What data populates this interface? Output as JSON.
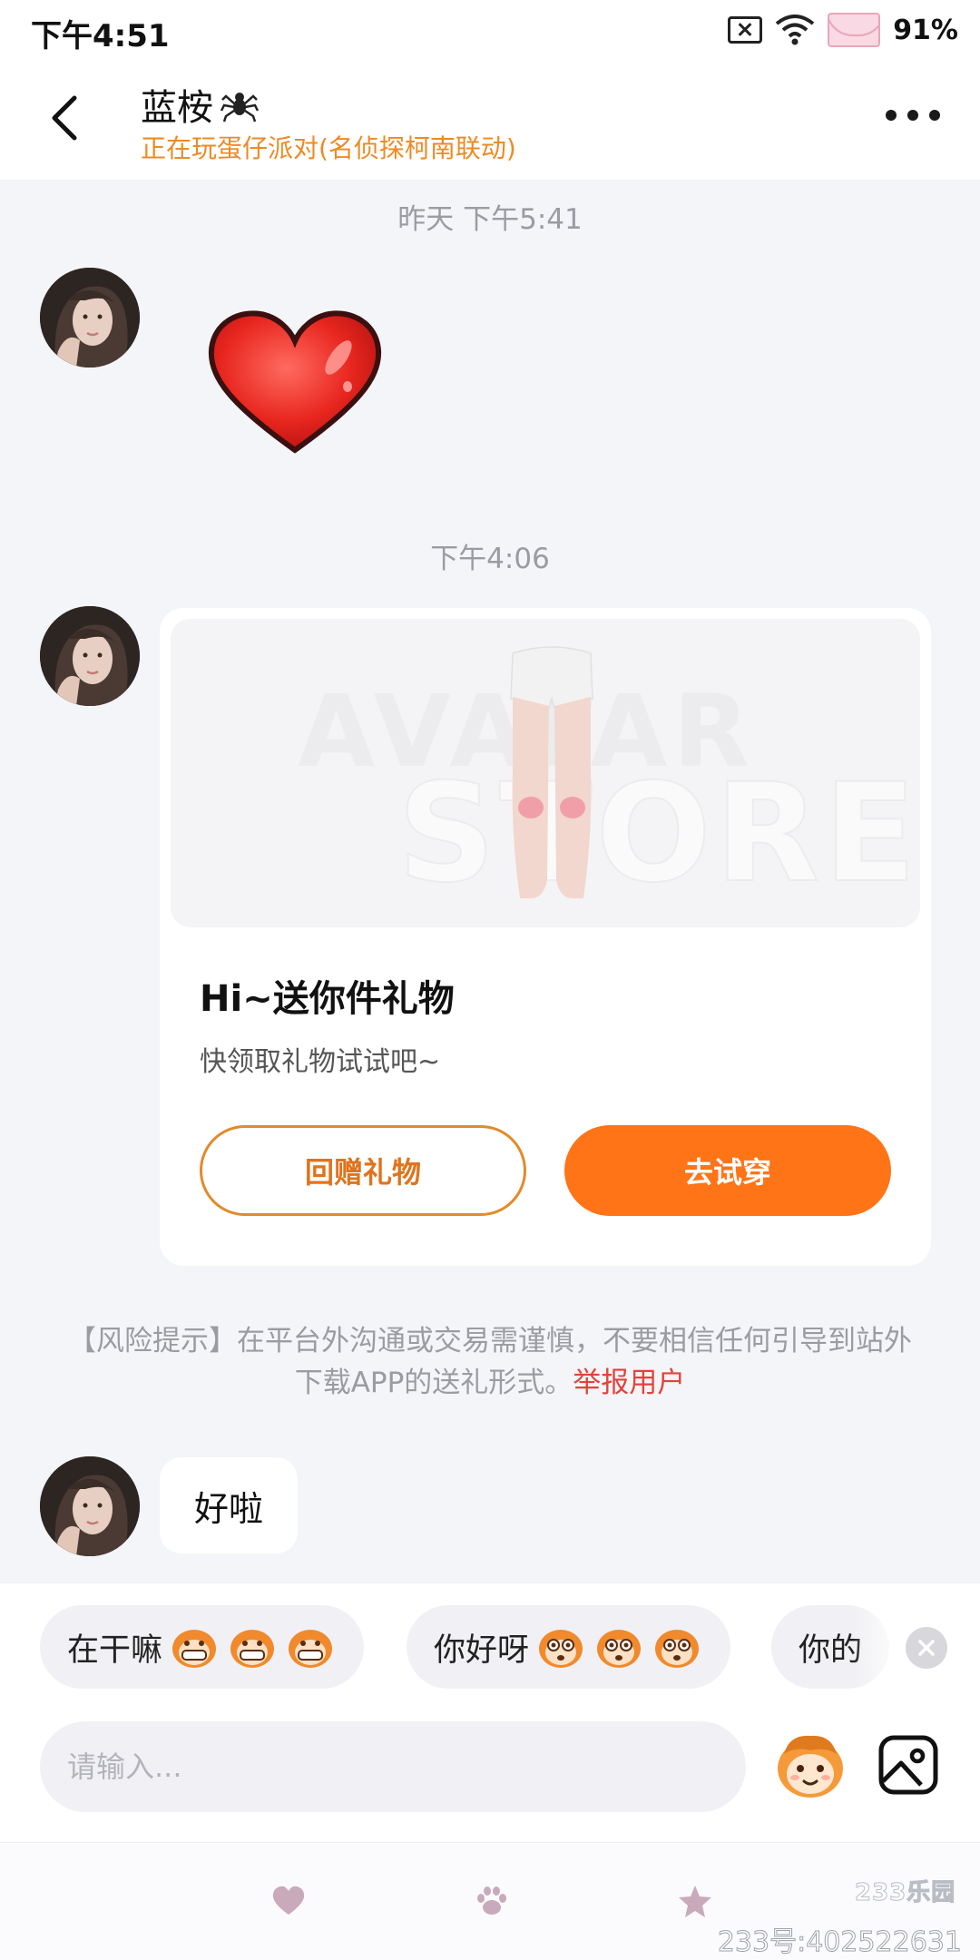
{
  "status_bar": {
    "time": "下午4:51",
    "battery": "91%"
  },
  "header": {
    "name": "蓝桉",
    "status": "正在玩蛋仔派对(名侦探柯南联动)"
  },
  "messages": {
    "timestamp_1": "昨天 下午5:41",
    "timestamp_2": "下午4:06",
    "gift_card": {
      "watermark_line1": "AVATAR",
      "watermark_line2": "STORE",
      "title": "Hi~送你件礼物",
      "subtitle": "快领取礼物试试吧~",
      "return_button": "回赠礼物",
      "try_button": "去试穿"
    },
    "risk_notice": {
      "text": "【风险提示】在平台外沟通或交易需谨慎，不要相信任何引导到站外下载APP的送礼形式。",
      "report_link": "举报用户"
    },
    "last_message": "好啦"
  },
  "quick_replies": [
    {
      "label": "在干嘛",
      "emoji": "grinning-monkey"
    },
    {
      "label": "你好呀",
      "emoji": "surprised-monkey"
    },
    {
      "label": "你的",
      "emoji": ""
    }
  ],
  "input": {
    "placeholder": "请输入..."
  },
  "footer": {
    "brand": "233乐园",
    "user_id": "233号:402522631"
  },
  "colors": {
    "accent": "#ff7417",
    "status": "#ee8a23",
    "report": "#e2433b"
  }
}
